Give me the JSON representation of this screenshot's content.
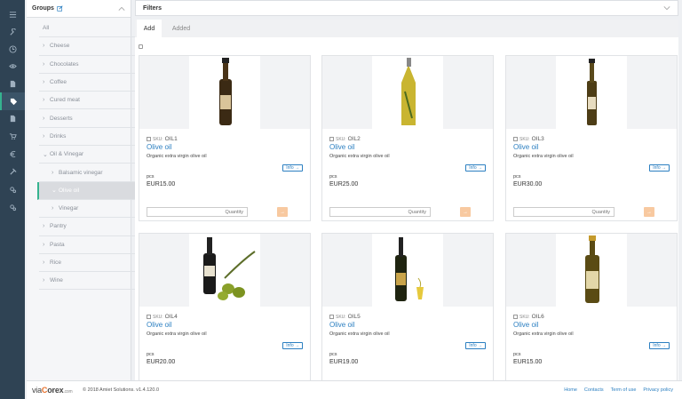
{
  "rail": {
    "icons": [
      "menu-icon",
      "wrench-icon",
      "clock-icon",
      "eye-icon",
      "document-icon",
      "tag-icon",
      "file-icon",
      "cart-icon",
      "euro-icon",
      "tool-icon",
      "gears-icon",
      "settings-icon"
    ]
  },
  "groups": {
    "title": "Groups",
    "items": [
      {
        "label": "All",
        "level": "all"
      },
      {
        "label": "Cheese",
        "level": "top",
        "chev": "›"
      },
      {
        "label": "Chocolates",
        "level": "top",
        "chev": "›"
      },
      {
        "label": "Coffee",
        "level": "top",
        "chev": "›"
      },
      {
        "label": "Cured meat",
        "level": "top",
        "chev": "›"
      },
      {
        "label": "Desserts",
        "level": "top",
        "chev": "›"
      },
      {
        "label": "Drinks",
        "level": "top",
        "chev": "›"
      },
      {
        "label": "Oil & Vinegar",
        "level": "top",
        "chev": "⌄"
      },
      {
        "label": "Balsamic vinegar",
        "level": "sub",
        "chev": "›"
      },
      {
        "label": "Olive oil",
        "level": "selected",
        "chev": "⌄"
      },
      {
        "label": "Vinegar",
        "level": "sub",
        "chev": "›"
      },
      {
        "label": "Pantry",
        "level": "top",
        "chev": "›"
      },
      {
        "label": "Pasta",
        "level": "top",
        "chev": "›"
      },
      {
        "label": "Rice",
        "level": "top",
        "chev": "›"
      },
      {
        "label": "Wine",
        "level": "top",
        "chev": "›"
      }
    ]
  },
  "filters": {
    "title": "Filters"
  },
  "tabs": {
    "add": "Add",
    "added": "Added"
  },
  "products": [
    {
      "sku_key": "SKU:",
      "sku": "OIL1",
      "name": "Olive oil",
      "desc": "Organic extra virgin olive oil",
      "info": "Info →",
      "unit": "pcs",
      "price": "EUR15.00",
      "qty_placeholder": "Quantity",
      "add": "→",
      "bottle": "dark"
    },
    {
      "sku_key": "SKU:",
      "sku": "OIL2",
      "name": "Olive oil",
      "desc": "Organic extra virgin olive oil",
      "info": "Info →",
      "unit": "pcs",
      "price": "EUR25.00",
      "qty_placeholder": "Quantity",
      "add": "→",
      "bottle": "clear"
    },
    {
      "sku_key": "SKU:",
      "sku": "OIL3",
      "name": "Olive oil",
      "desc": "Organic extra virgin olive oil",
      "info": "Info →",
      "unit": "pcs",
      "price": "EUR30.00",
      "qty_placeholder": "Quantity",
      "add": "→",
      "bottle": "slim"
    },
    {
      "sku_key": "SKU:",
      "sku": "OIL4",
      "name": "Olive oil",
      "desc": "Organic extra virgin olive oil",
      "info": "Info →",
      "unit": "pcs",
      "price": "EUR20.00",
      "qty_placeholder": "Quantity",
      "add": "→",
      "bottle": "olives"
    },
    {
      "sku_key": "SKU:",
      "sku": "OIL5",
      "name": "Olive oil",
      "desc": "Organic extra virgin olive oil",
      "info": "Info →",
      "unit": "pcs",
      "price": "EUR19.00",
      "qty_placeholder": "Quantity",
      "add": "→",
      "bottle": "glass"
    },
    {
      "sku_key": "SKU:",
      "sku": "OIL6",
      "name": "Olive oil",
      "desc": "Organic extra virgin olive oil",
      "info": "Info →",
      "unit": "pcs",
      "price": "EUR15.00",
      "qty_placeholder": "Quantity",
      "add": "→",
      "bottle": "wide"
    }
  ],
  "footer": {
    "logo_via": "via",
    "logo_c": "C",
    "logo_orex": "orex",
    "logo_com": ".com",
    "copyright": "© 2018 Amiet Solutions. v1.4.120.0",
    "links": [
      "Home",
      "Contacts",
      "Term of use",
      "Privacy policy"
    ]
  },
  "colors": {
    "rail": "#2f4354",
    "accent": "#35b38f",
    "link": "#2b7fc1",
    "add_button": "#f8c9a0"
  }
}
